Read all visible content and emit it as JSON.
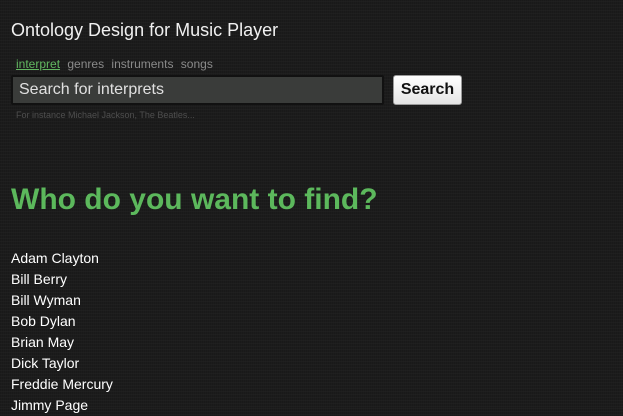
{
  "header": {
    "title": "Ontology Design for Music Player"
  },
  "tabs": [
    {
      "label": "interpret",
      "active": true
    },
    {
      "label": "genres",
      "active": false
    },
    {
      "label": "instruments",
      "active": false
    },
    {
      "label": "songs",
      "active": false
    }
  ],
  "search": {
    "placeholder": "Search for interprets",
    "value": "",
    "button_label": "Search",
    "hint": "For instance Michael Jackson, The Beatles..."
  },
  "main": {
    "heading": "Who do you want to find?",
    "results": [
      "Adam Clayton",
      "Bill Berry",
      "Bill Wyman",
      "Bob Dylan",
      "Brian May",
      "Dick Taylor",
      "Freddie Mercury",
      "Jimmy Page"
    ]
  },
  "colors": {
    "background": "#1c1c1c",
    "accent_green": "#5cb85c",
    "active_tab": "#62b861",
    "inactive_tab": "#8a8a8a"
  }
}
